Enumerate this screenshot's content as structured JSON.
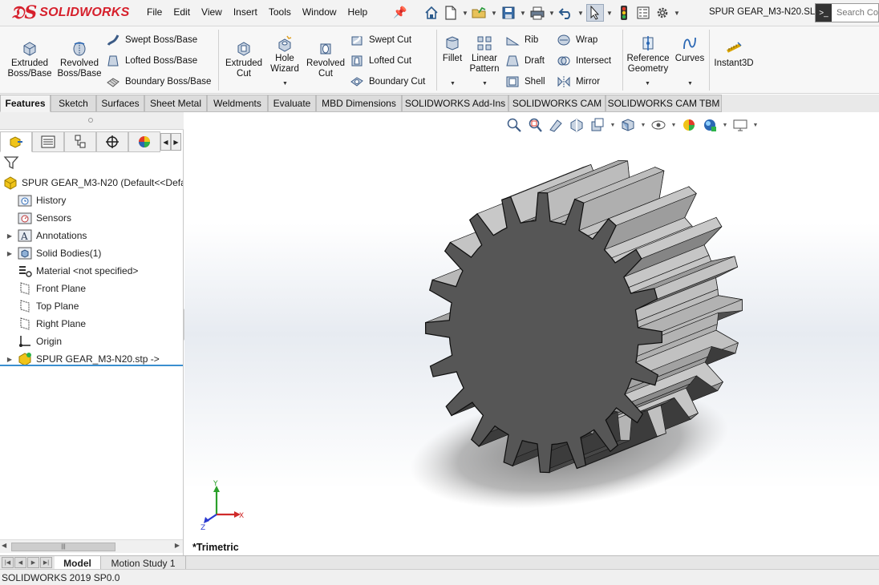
{
  "app": {
    "brand": "SOLIDWORKS",
    "doc_title": "SPUR GEAR_M3-N20.SL...",
    "search_placeholder": "Search Co"
  },
  "menu": [
    "File",
    "Edit",
    "View",
    "Insert",
    "Tools",
    "Window",
    "Help"
  ],
  "ribbon": {
    "extruded_boss": [
      "Extruded",
      "Boss/Base"
    ],
    "revolved_boss": [
      "Revolved",
      "Boss/Base"
    ],
    "swept_boss": "Swept Boss/Base",
    "lofted_boss": "Lofted Boss/Base",
    "boundary_boss": "Boundary Boss/Base",
    "extruded_cut": [
      "Extruded",
      "Cut"
    ],
    "hole_wizard": [
      "Hole",
      "Wizard"
    ],
    "revolved_cut": [
      "Revolved",
      "Cut"
    ],
    "swept_cut": "Swept Cut",
    "lofted_cut": "Lofted Cut",
    "boundary_cut": "Boundary Cut",
    "fillet": "Fillet",
    "linear_pattern": [
      "Linear",
      "Pattern"
    ],
    "rib": "Rib",
    "draft": "Draft",
    "shell": "Shell",
    "wrap": "Wrap",
    "intersect": "Intersect",
    "mirror": "Mirror",
    "reference_geometry": [
      "Reference",
      "Geometry"
    ],
    "curves": "Curves",
    "instant3d": "Instant3D"
  },
  "tabs": [
    "Features",
    "Sketch",
    "Surfaces",
    "Sheet Metal",
    "Weldments",
    "Evaluate",
    "MBD Dimensions",
    "SOLIDWORKS Add-Ins",
    "SOLIDWORKS CAM",
    "SOLIDWORKS CAM TBM"
  ],
  "tree": {
    "root": "SPUR GEAR_M3-N20  (Default<<Defau",
    "items": [
      {
        "label": "History",
        "icon": "history-icon"
      },
      {
        "label": "Sensors",
        "icon": "sensors-icon"
      },
      {
        "label": "Annotations",
        "icon": "annotations-icon"
      },
      {
        "label": "Solid Bodies(1)",
        "icon": "solid-bodies-icon"
      },
      {
        "label": "Material <not specified>",
        "icon": "material-icon"
      },
      {
        "label": "Front Plane",
        "icon": "plane-icon"
      },
      {
        "label": "Top Plane",
        "icon": "plane-icon"
      },
      {
        "label": "Right Plane",
        "icon": "plane-icon"
      },
      {
        "label": "Origin",
        "icon": "origin-icon"
      },
      {
        "label": "SPUR GEAR_M3-N20.stp ->",
        "icon": "imported-part-icon"
      }
    ]
  },
  "viewport": {
    "view_orientation": "*Trimetric",
    "triad_x": "X",
    "triad_y": "Y",
    "triad_z": "Z"
  },
  "bottom_tabs": [
    "Model",
    "Motion Study 1"
  ],
  "status": "SOLIDWORKS 2019 SP0.0",
  "colors": {
    "brand_red": "#d6202c",
    "gear_face": "#565656",
    "selection_blue": "#3a8fd0"
  }
}
